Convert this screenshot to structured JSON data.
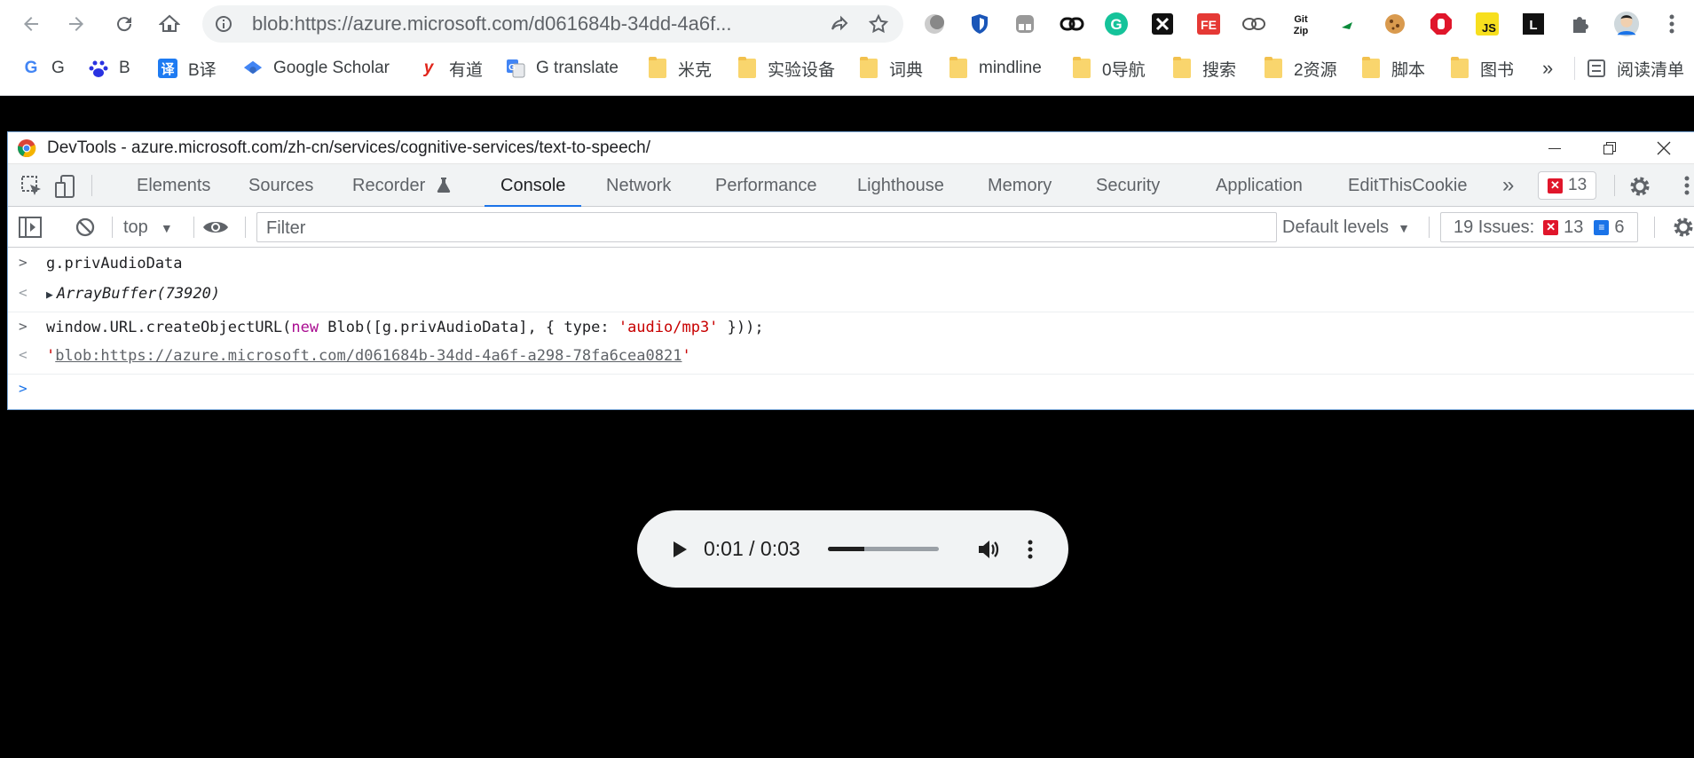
{
  "browser": {
    "address": {
      "url": "blob:https://azure.microsoft.com/d061684b-34dd-4a6f..."
    },
    "bookmarks": [
      {
        "label": "G",
        "icon": "google-icon",
        "color": "#4285f4"
      },
      {
        "label": "B",
        "icon": "baidu-icon",
        "color": "#2932e1"
      },
      {
        "label": "B译",
        "icon": "baidu-translate-icon",
        "color": "#1e7bf2"
      },
      {
        "label": "Google Scholar",
        "icon": "scholar-icon",
        "color": "#4285f4"
      },
      {
        "label": "有道",
        "icon": "youdao-icon",
        "color": "#e1251b"
      },
      {
        "label": "G translate",
        "icon": "translate-icon",
        "color": "#4285f4"
      },
      {
        "label": "米克",
        "icon": "folder-icon"
      },
      {
        "label": "实验设备",
        "icon": "folder-icon"
      },
      {
        "label": "词典",
        "icon": "folder-icon"
      },
      {
        "label": "mindline",
        "icon": "folder-icon"
      },
      {
        "label": "0导航",
        "icon": "folder-icon"
      },
      {
        "label": "搜索",
        "icon": "folder-icon"
      },
      {
        "label": "2资源",
        "icon": "folder-icon"
      },
      {
        "label": "脚本",
        "icon": "folder-icon"
      },
      {
        "label": "图书",
        "icon": "folder-icon"
      }
    ],
    "bookmarks_overflow": "»",
    "reading_list": "阅读清单"
  },
  "devtools": {
    "title": "DevTools - azure.microsoft.com/zh-cn/services/cognitive-services/text-to-speech/",
    "tabs": [
      "Elements",
      "Sources",
      "Recorder",
      "Console",
      "Network",
      "Performance",
      "Lighthouse",
      "Memory",
      "Security",
      "Application",
      "EditThisCookie"
    ],
    "active_tab": "Console",
    "error_count": "13",
    "context": "top",
    "filter_placeholder": "Filter",
    "levels": "Default levels",
    "issues_label": "19 Issues:",
    "issues_errors": "13",
    "issues_info": "6",
    "console": {
      "line1_input": "g.privAudioData",
      "line1_output": "ArrayBuffer(73920)",
      "line2_input_pre": "window.URL.createObjectURL(",
      "line2_input_kw": "new",
      "line2_input_mid": " Blob([g.privAudioData], { type: ",
      "line2_input_str": "'audio/mp3'",
      "line2_input_post": " }));",
      "line2_output_quote_open": "'",
      "line2_output_link": "blob:https://azure.microsoft.com/d061684b-34dd-4a6f-a298-78fa6cea0821",
      "line2_output_quote_close": "'"
    }
  },
  "player": {
    "time": "0:01 / 0:03",
    "progress_fraction": 0.33
  },
  "colors": {
    "accent": "#1a73e8",
    "error": "#e0162b",
    "string": "#c80000",
    "keyword": "#aa0d91"
  }
}
